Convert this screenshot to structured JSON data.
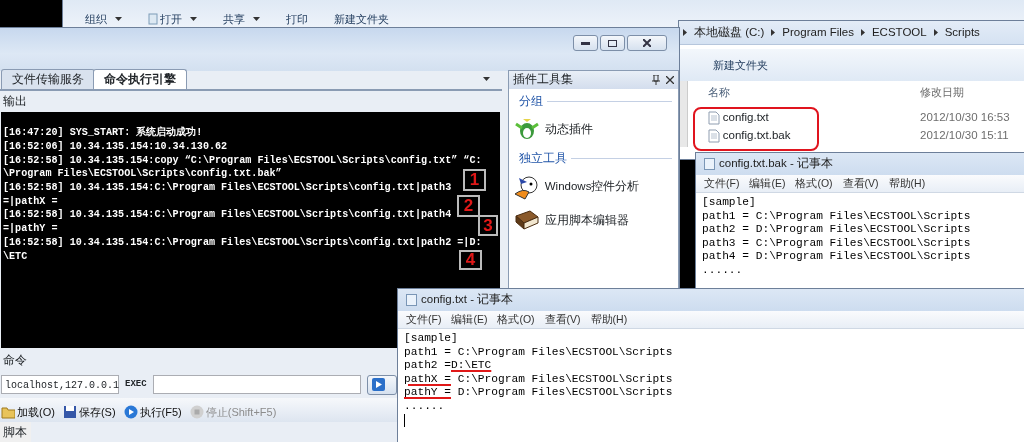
{
  "explorer_back": {
    "toolbar": [
      {
        "label": "组织",
        "icon": false,
        "dropdown": true
      },
      {
        "label": "打开",
        "icon": true,
        "dropdown": true
      },
      {
        "label": "共享",
        "icon": false,
        "dropdown": true
      },
      {
        "label": "打印",
        "icon": false,
        "dropdown": false
      },
      {
        "label": "新建文件夹",
        "icon": false,
        "dropdown": false
      }
    ]
  },
  "explorer_front": {
    "breadcrumb": [
      "本地磁盘 (C:)",
      "Program Files",
      "ECSTOOL",
      "Scripts"
    ],
    "toolbar": [
      "新建文件夹"
    ],
    "columns": [
      "名称",
      "修改日期"
    ],
    "files": [
      {
        "name": "config.txt",
        "modified": "2012/10/30 16:53"
      },
      {
        "name": "config.txt.bak",
        "modified": "2012/10/30 15:11"
      }
    ]
  },
  "main_window": {
    "tabs": [
      {
        "label": "文件传输服务",
        "selected": false
      },
      {
        "label": "命令执行引擎",
        "selected": true
      }
    ],
    "output_label": "输出",
    "console_lines": [
      "[16:47:20] SYS_START: 系统启动成功!",
      "[16:52:06] 10.34.135.154:10.34.130.62",
      "[16:52:58] 10.34.135.154:copy “C:\\Program Files\\ECSTOOL\\Scripts\\config.txt” “C:",
      "\\Program Files\\ECSTOOL\\Scripts\\config.txt.bak”",
      "[16:52:58] 10.34.135.154:C:\\Program Files\\ECSTOOL\\Scripts\\config.txt|path3",
      "=|pathX =",
      "[16:52:58] 10.34.135.154:C:\\Program Files\\ECSTOOL\\Scripts\\config.txt|path4",
      "=|pathY =",
      "[16:52:58] 10.34.135.154:C:\\Program Files\\ECSTOOL\\Scripts\\config.txt|path2 =|D:",
      "\\ETC"
    ],
    "markers": [
      "1",
      "2",
      "3",
      "4"
    ],
    "command_label": "命令",
    "host_field": "localhost,127.0.0.1",
    "exec_label": "EXEC",
    "toolbar": [
      {
        "label": "加载(O)",
        "kind": "load",
        "disabled": false
      },
      {
        "label": "保存(S)",
        "kind": "save",
        "disabled": false
      },
      {
        "label": "执行(F5)",
        "kind": "run",
        "disabled": false
      },
      {
        "label": "停止(Shift+F5)",
        "kind": "stop",
        "disabled": true
      }
    ],
    "script_label": "脚本",
    "plugin_panel": {
      "title": "插件工具集",
      "groups": [
        {
          "title": "分组",
          "items": [
            {
              "label": "动态插件",
              "kind": "bird"
            }
          ]
        },
        {
          "title": "独立工具",
          "items": [
            {
              "label": "Windows控件分析",
              "kind": "duck"
            },
            {
              "label": "应用脚本编辑器",
              "kind": "book"
            }
          ]
        }
      ]
    }
  },
  "notepad_bak": {
    "title": "config.txt.bak - 记事本",
    "menu": [
      "文件(F)",
      "编辑(E)",
      "格式(O)",
      "查看(V)",
      "帮助(H)"
    ],
    "lines": [
      "[sample]",
      "path1 = C:\\Program Files\\ECSTOOL\\Scripts",
      "path2 = D:\\Program Files\\ECSTOOL\\Scripts",
      "path3 = C:\\Program Files\\ECSTOOL\\Scripts",
      "path4 = D:\\Program Files\\ECSTOOL\\Scripts",
      "......"
    ]
  },
  "notepad_config": {
    "title": "config.txt - 记事本",
    "menu": [
      "文件(F)",
      "编辑(E)",
      "格式(O)",
      "查看(V)",
      "帮助(H)"
    ],
    "lines": [
      [
        {
          "text": "[sample]",
          "underlined": false
        }
      ],
      [
        {
          "text": "path1 = C:\\Program Files\\ECSTOOL\\Scripts",
          "underlined": false
        }
      ],
      [
        {
          "text": "path2 =",
          "underlined": false
        },
        {
          "text": "D:\\ETC",
          "underlined": true
        }
      ],
      [
        {
          "text": "pathX =",
          "underlined": true
        },
        {
          "text": " C:\\Program Files\\ECSTOOL\\Scripts",
          "underlined": false
        }
      ],
      [
        {
          "text": "pathY =",
          "underlined": true
        },
        {
          "text": " D:\\Program Files\\ECSTOOL\\Scripts",
          "underlined": false
        }
      ],
      [
        {
          "text": "......",
          "underlined": false
        }
      ]
    ]
  }
}
